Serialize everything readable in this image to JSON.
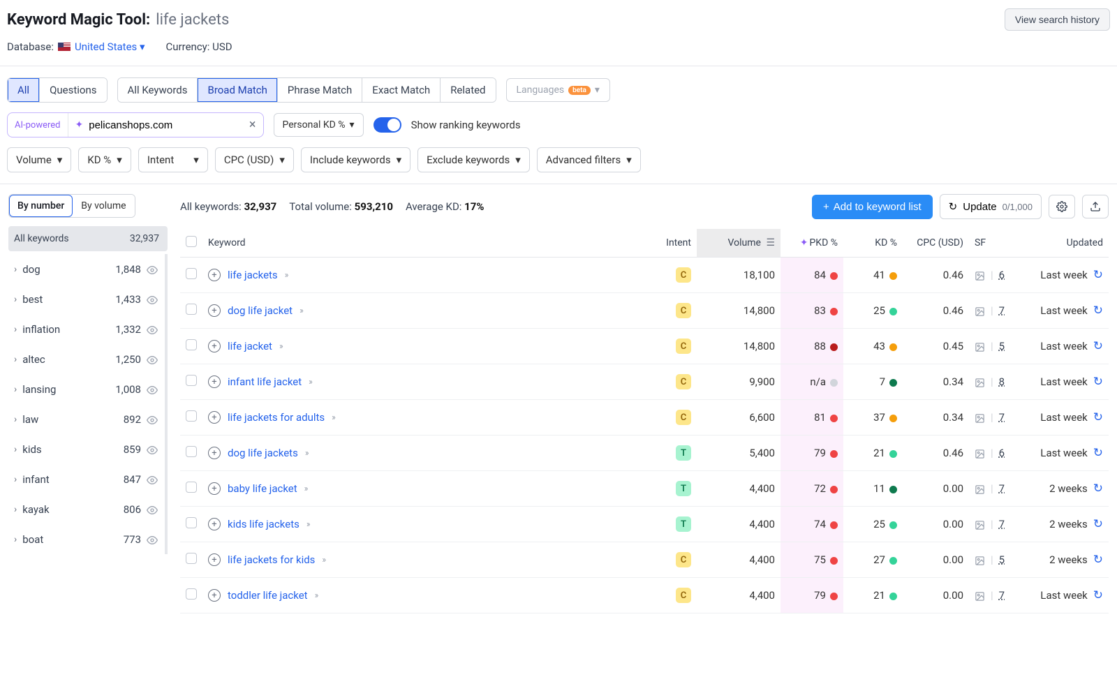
{
  "header": {
    "tool_name": "Keyword Magic Tool:",
    "query": "life jackets",
    "history_btn": "View search history",
    "database_label": "Database:",
    "database_value": "United States",
    "currency_label": "Currency:",
    "currency_value": "USD"
  },
  "tabs_left": {
    "all": "All",
    "questions": "Questions"
  },
  "tabs_match": {
    "all_kw": "All Keywords",
    "broad": "Broad Match",
    "phrase": "Phrase Match",
    "exact": "Exact Match",
    "related": "Related"
  },
  "languages_btn": "Languages",
  "beta_label": "beta",
  "ai": {
    "label": "AI-powered",
    "domain": "pelicanshops.com",
    "pkd_btn": "Personal KD %",
    "toggle_label": "Show ranking keywords"
  },
  "filters": {
    "volume": "Volume",
    "kd": "KD %",
    "intent": "Intent",
    "cpc": "CPC (USD)",
    "include": "Include keywords",
    "exclude": "Exclude keywords",
    "advanced": "Advanced filters"
  },
  "sidebar": {
    "by_number": "By number",
    "by_volume": "By volume",
    "all_label": "All keywords",
    "all_count": "32,937",
    "groups": [
      {
        "label": "dog",
        "count": "1,848"
      },
      {
        "label": "best",
        "count": "1,433"
      },
      {
        "label": "inflation",
        "count": "1,332"
      },
      {
        "label": "altec",
        "count": "1,250"
      },
      {
        "label": "lansing",
        "count": "1,008"
      },
      {
        "label": "law",
        "count": "892"
      },
      {
        "label": "kids",
        "count": "859"
      },
      {
        "label": "infant",
        "count": "847"
      },
      {
        "label": "kayak",
        "count": "806"
      },
      {
        "label": "boat",
        "count": "773"
      }
    ]
  },
  "stats": {
    "all_kw_label": "All keywords:",
    "all_kw_val": "32,937",
    "tot_vol_label": "Total volume:",
    "tot_vol_val": "593,210",
    "avg_kd_label": "Average KD:",
    "avg_kd_val": "17%"
  },
  "actions": {
    "add_list": "Add to keyword list",
    "update": "Update",
    "update_count": "0/1,000"
  },
  "columns": {
    "keyword": "Keyword",
    "intent": "Intent",
    "volume": "Volume",
    "pkd": "PKD %",
    "kd": "KD %",
    "cpc": "CPC (USD)",
    "sf": "SF",
    "updated": "Updated"
  },
  "rows": [
    {
      "kw": "life jackets",
      "intent": "C",
      "vol": "18,100",
      "pkd": "84",
      "pkd_dot": "d-red",
      "kd": "41",
      "kd_dot": "d-orange",
      "cpc": "0.46",
      "sf": "6",
      "upd": "Last week"
    },
    {
      "kw": "dog life jacket",
      "intent": "C",
      "vol": "14,800",
      "pkd": "83",
      "pkd_dot": "d-red",
      "kd": "25",
      "kd_dot": "d-green",
      "cpc": "0.46",
      "sf": "7",
      "upd": "Last week"
    },
    {
      "kw": "life jacket",
      "intent": "C",
      "vol": "14,800",
      "pkd": "88",
      "pkd_dot": "d-darkred",
      "kd": "43",
      "kd_dot": "d-orange",
      "cpc": "0.45",
      "sf": "5",
      "upd": "Last week"
    },
    {
      "kw": "infant life jacket",
      "intent": "C",
      "vol": "9,900",
      "pkd": "n/a",
      "pkd_dot": "d-grey",
      "kd": "7",
      "kd_dot": "d-darkgreen",
      "cpc": "0.34",
      "sf": "8",
      "upd": "Last week"
    },
    {
      "kw": "life jackets for adults",
      "intent": "C",
      "vol": "6,600",
      "pkd": "81",
      "pkd_dot": "d-red",
      "kd": "37",
      "kd_dot": "d-orange",
      "cpc": "0.34",
      "sf": "7",
      "upd": "Last week"
    },
    {
      "kw": "dog life jackets",
      "intent": "T",
      "vol": "5,400",
      "pkd": "79",
      "pkd_dot": "d-red",
      "kd": "21",
      "kd_dot": "d-green",
      "cpc": "0.46",
      "sf": "6",
      "upd": "Last week"
    },
    {
      "kw": "baby life jacket",
      "intent": "T",
      "vol": "4,400",
      "pkd": "72",
      "pkd_dot": "d-red",
      "kd": "11",
      "kd_dot": "d-darkgreen",
      "cpc": "0.00",
      "sf": "7",
      "upd": "2 weeks"
    },
    {
      "kw": "kids life jackets",
      "intent": "T",
      "vol": "4,400",
      "pkd": "74",
      "pkd_dot": "d-red",
      "kd": "25",
      "kd_dot": "d-green",
      "cpc": "0.00",
      "sf": "7",
      "upd": "2 weeks"
    },
    {
      "kw": "life jackets for kids",
      "intent": "C",
      "vol": "4,400",
      "pkd": "75",
      "pkd_dot": "d-red",
      "kd": "27",
      "kd_dot": "d-green",
      "cpc": "0.00",
      "sf": "5",
      "upd": "2 weeks"
    },
    {
      "kw": "toddler life jacket",
      "intent": "C",
      "vol": "4,400",
      "pkd": "79",
      "pkd_dot": "d-red",
      "kd": "21",
      "kd_dot": "d-green",
      "cpc": "0.00",
      "sf": "7",
      "upd": "Last week"
    }
  ]
}
